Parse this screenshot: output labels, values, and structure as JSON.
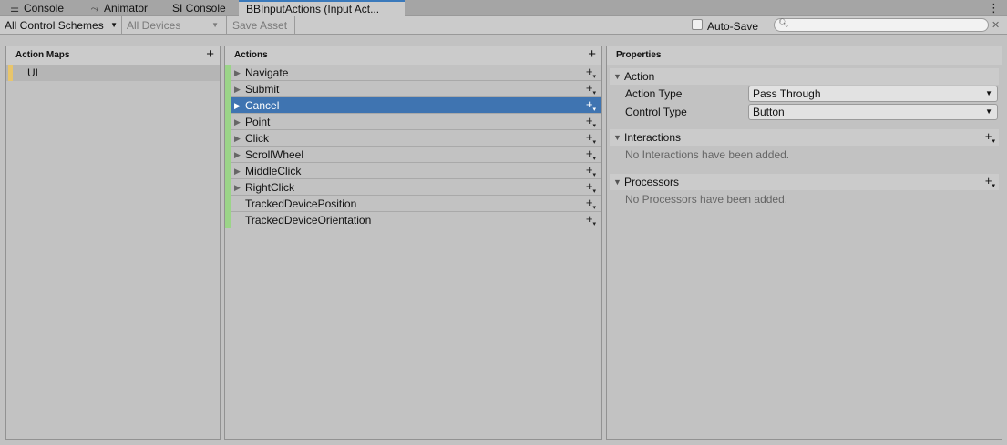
{
  "tabs": [
    {
      "label": "Console",
      "icon": "console-icon"
    },
    {
      "label": "Animator",
      "icon": "animator-icon"
    },
    {
      "label": "SI Console",
      "icon": ""
    },
    {
      "label": "BBInputActions (Input Act...",
      "icon": ""
    }
  ],
  "toolbar": {
    "control_schemes": "All Control Schemes",
    "devices": "All Devices",
    "save_asset": "Save Asset",
    "auto_save": "Auto-Save",
    "auto_save_checked": false,
    "search_placeholder": ""
  },
  "action_maps": {
    "header": "Action Maps",
    "items": [
      {
        "label": "UI"
      }
    ]
  },
  "actions": {
    "header": "Actions",
    "items": [
      {
        "label": "Navigate",
        "expandable": true
      },
      {
        "label": "Submit",
        "expandable": true
      },
      {
        "label": "Cancel",
        "expandable": true,
        "selected": true
      },
      {
        "label": "Point",
        "expandable": true
      },
      {
        "label": "Click",
        "expandable": true
      },
      {
        "label": "ScrollWheel",
        "expandable": true
      },
      {
        "label": "MiddleClick",
        "expandable": true
      },
      {
        "label": "RightClick",
        "expandable": true
      },
      {
        "label": "TrackedDevicePosition",
        "expandable": false
      },
      {
        "label": "TrackedDeviceOrientation",
        "expandable": false
      }
    ]
  },
  "properties": {
    "header": "Properties",
    "action_section": "Action",
    "action_type_label": "Action Type",
    "action_type_value": "Pass Through",
    "control_type_label": "Control Type",
    "control_type_value": "Button",
    "interactions_section": "Interactions",
    "interactions_empty": "No Interactions have been added.",
    "processors_section": "Processors",
    "processors_empty": "No Processors have been added."
  },
  "colors": {
    "selection": "#3f74b1",
    "action_bar": "#9bd488",
    "map_bar": "#e8c56b",
    "active_tab_border": "#3a79bb"
  }
}
